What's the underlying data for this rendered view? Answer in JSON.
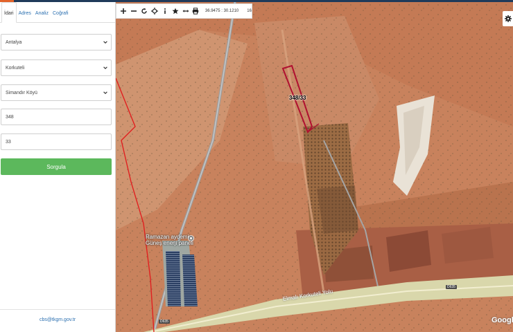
{
  "tabs": [
    {
      "label": "İdari",
      "active": true
    },
    {
      "label": "Adres",
      "active": false
    },
    {
      "label": "Analiz",
      "active": false
    },
    {
      "label": "Coğrafi",
      "active": false
    }
  ],
  "form": {
    "il": "Antalya",
    "ilce": "Korkuteli",
    "mahalle": "Simandır Köyü",
    "ada": "348",
    "parsel": "33",
    "submit_label": "Sorgula"
  },
  "footer": {
    "email": "cbs@tkgm.gov.tr"
  },
  "toolbar": {
    "icons": [
      "zoom-in-icon",
      "zoom-out-icon",
      "refresh-icon",
      "locate-icon",
      "info-icon",
      "star-icon",
      "measure-icon",
      "print-icon"
    ],
    "coordinates": "36.9475 : 30.1210",
    "zoom_level": "16"
  },
  "map": {
    "parcel_label": "348/33",
    "poi_label_line1": "Ramazan aydemir",
    "poi_label_line2": "Güneş enerji paneli",
    "road_label": "Elmalı Korkuteli Yolu",
    "road_shield_1": "D635",
    "road_shield_2": "D635",
    "attribution": "Google"
  },
  "colors": {
    "accent_green": "#5cb85c",
    "link_blue": "#2a6fb0",
    "parcel_border": "#b01030",
    "boundary_red": "#e02020"
  }
}
